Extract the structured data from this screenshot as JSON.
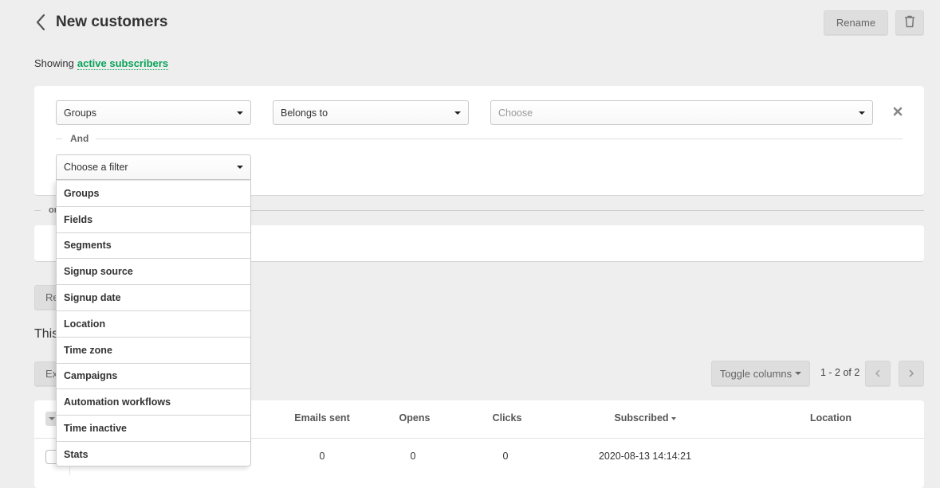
{
  "header": {
    "title": "New customers",
    "rename_label": "Rename",
    "back_icon": "chevron-left-icon",
    "delete_icon": "trash-icon"
  },
  "showing": {
    "prefix": "Showing",
    "link": "active subscribers"
  },
  "filters": {
    "rule1": {
      "field": "Groups",
      "operator": "Belongs to",
      "value_placeholder": "Choose",
      "remove_icon": "close-icon"
    },
    "and_label": "And",
    "new_filter_placeholder": "Choose a filter",
    "or_label_visible": "or"
  },
  "dropdown": {
    "items": [
      "Groups",
      "Fields",
      "Segments",
      "Signup source",
      "Signup date",
      "Location",
      "Time zone",
      "Campaigns",
      "Automation workflows",
      "Time inactive",
      "Stats"
    ]
  },
  "actions": {
    "reset_visible": "Re",
    "summary_visible": "This",
    "export_visible": "Ex"
  },
  "toolbar": {
    "toggle_columns": "Toggle columns",
    "pager": "1 - 2 of 2",
    "prev_icon": "chevron-left-icon",
    "next_icon": "chevron-right-icon"
  },
  "table": {
    "columns": [
      "Emails sent",
      "Opens",
      "Clicks",
      "Subscribed",
      "Location"
    ],
    "sorted_column": "Subscribed",
    "rows": [
      {
        "emails_sent": "0",
        "opens": "0",
        "clicks": "0",
        "subscribed": "2020-08-13 14:14:21",
        "location": ""
      }
    ]
  },
  "colors": {
    "accent_green": "#09a35a",
    "background": "#eeeeee"
  }
}
